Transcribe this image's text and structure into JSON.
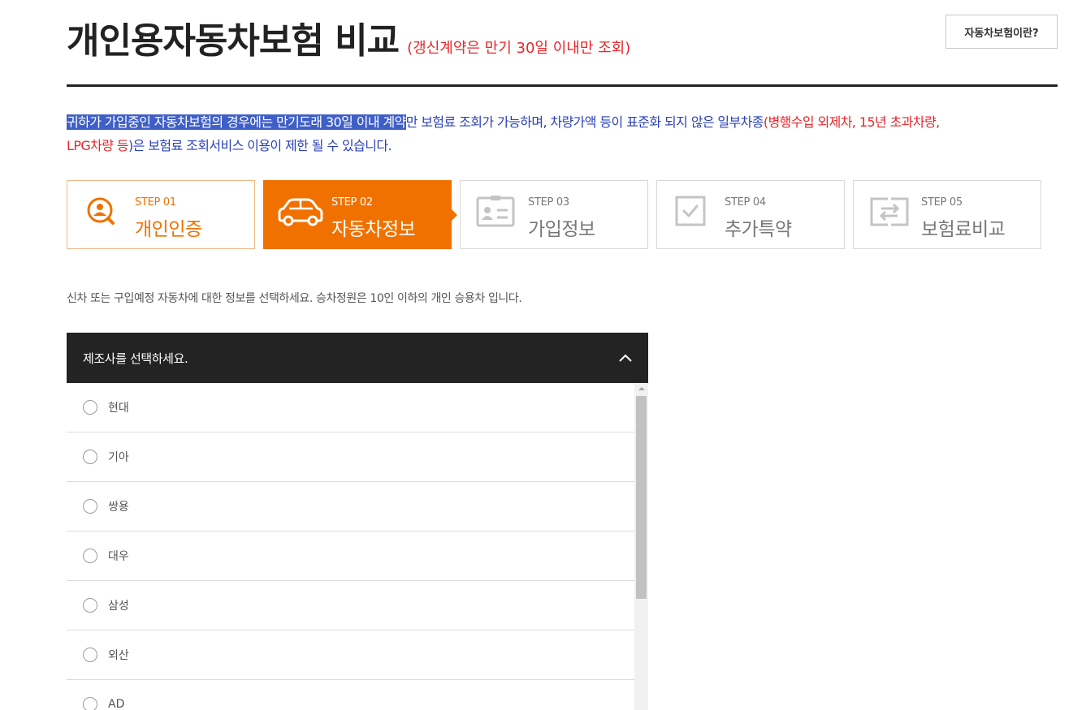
{
  "header": {
    "title": "개인용자동차보험 비교",
    "subtitle": "(갱신계약은 만기 30일 이내만 조회)",
    "info_button": "자동차보험이란?"
  },
  "notice": {
    "highlighted": "귀하가 가입중인 자동차보험의 경우에는 만기도래 30일 이내 계약",
    "part1": "만 보험료 조회가 가능하며, 차량가액 등이 표준화 되지 않은 일부차종",
    "red1": "(병행수입 외제차, 15년 초과차량,",
    "red2": "LPG차량 등",
    "part2": ")은 보험료 조회서비스 이용이 제한 될 수 있습니다."
  },
  "steps": [
    {
      "num": "STEP 01",
      "name": "개인인증",
      "icon": "user-search-icon",
      "state": "done"
    },
    {
      "num": "STEP 02",
      "name": "자동차정보",
      "icon": "car-icon",
      "state": "active"
    },
    {
      "num": "STEP 03",
      "name": "가입정보",
      "icon": "id-card-icon",
      "state": "inactive"
    },
    {
      "num": "STEP 04",
      "name": "추가특약",
      "icon": "checkbox-icon",
      "state": "inactive"
    },
    {
      "num": "STEP 05",
      "name": "보험료비교",
      "icon": "compare-icon",
      "state": "inactive"
    }
  ],
  "guide": "신차 또는 구입예정 자동차에 대한 정보를 선택하세요. 승차정원은 10인 이하의 개인 승용차 입니다.",
  "maker_select": {
    "label": "제조사를 선택하세요.",
    "options": [
      "현대",
      "기아",
      "쌍용",
      "대우",
      "삼성",
      "외산",
      "AD"
    ]
  },
  "colors": {
    "accent": "#f07100",
    "notice_blue": "#2b41b9",
    "notice_red": "#e8262a",
    "header_dark": "#232323"
  }
}
